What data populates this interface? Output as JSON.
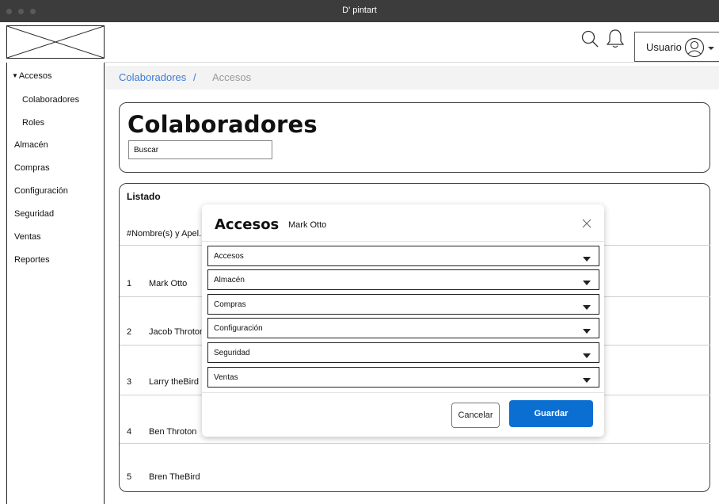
{
  "window": {
    "title": "D' pintart"
  },
  "header": {
    "user_label": "Usuario"
  },
  "sidebar": {
    "items": [
      {
        "label": "Accesos"
      },
      {
        "label": "Colaboradores"
      },
      {
        "label": "Roles"
      },
      {
        "label": "Almacén"
      },
      {
        "label": "Compras"
      },
      {
        "label": "Configuración"
      },
      {
        "label": "Seguridad"
      },
      {
        "label": "Ventas"
      },
      {
        "label": "Reportes"
      }
    ]
  },
  "breadcrumb": {
    "parent": "Colaboradores",
    "separator": "/",
    "current": "Accesos"
  },
  "page": {
    "title": "Colaboradores",
    "search_placeholder": "Buscar"
  },
  "list": {
    "title": "Listado",
    "header": "#Nombre(s) y Apel...",
    "rows": [
      {
        "num": "1",
        "name": "Mark Otto"
      },
      {
        "num": "2",
        "name": "Jacob Throton"
      },
      {
        "num": "3",
        "name": "Larry theBird"
      },
      {
        "num": "4",
        "name": "Ben Throton"
      },
      {
        "num": "5",
        "name": "Bren TheBird"
      }
    ]
  },
  "modal": {
    "title": "Accesos",
    "subtitle": "Mark Otto",
    "selects": [
      {
        "label": "Accesos"
      },
      {
        "label": "Almacén"
      },
      {
        "label": "Compras"
      },
      {
        "label": "Configuración"
      },
      {
        "label": "Seguridad"
      },
      {
        "label": "Ventas"
      }
    ],
    "cancel_label": "Cancelar",
    "save_label": "Guardar"
  },
  "icons": {
    "search": "search-icon",
    "bell": "bell-icon",
    "avatar": "user-avatar-icon",
    "caret": "caret-down-icon",
    "close": "close-icon"
  },
  "colors": {
    "accent": "#0b6fd1",
    "link": "#3a7bd5",
    "titlebar": "#3c3c3c"
  }
}
